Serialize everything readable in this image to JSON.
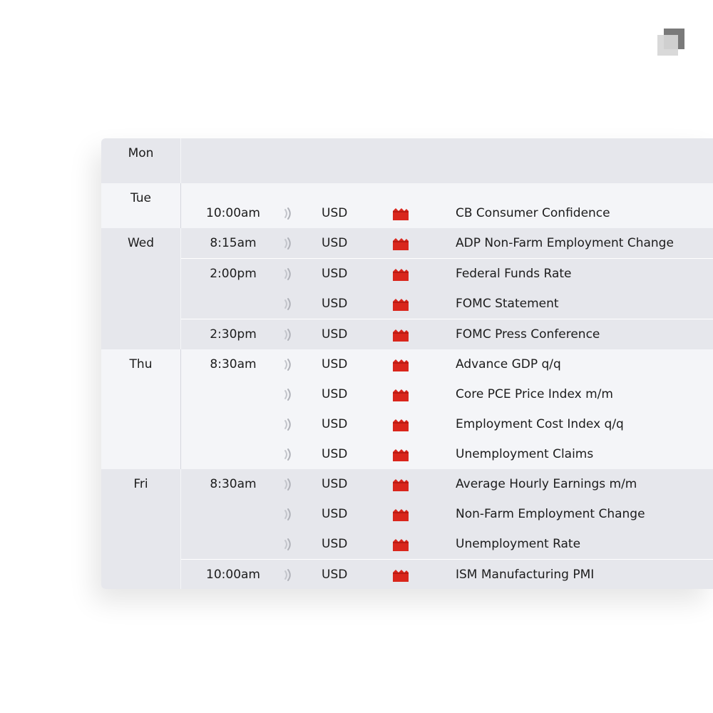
{
  "brand": {
    "logo": "square-logo"
  },
  "colors": {
    "impact_red": "#d9261c",
    "row_shade": "#e6e7ec",
    "row_light": "#f4f5f8"
  },
  "days": [
    {
      "label": "Mon",
      "groups": []
    },
    {
      "label": "Tue",
      "groups": [
        {
          "time": "10:00am",
          "events": [
            {
              "currency": "USD",
              "title": "CB Consumer Confidence"
            }
          ]
        }
      ]
    },
    {
      "label": "Wed",
      "groups": [
        {
          "time": "8:15am",
          "events": [
            {
              "currency": "USD",
              "title": "ADP Non-Farm Employment Change"
            }
          ]
        },
        {
          "time": "2:00pm",
          "events": [
            {
              "currency": "USD",
              "title": "Federal Funds Rate"
            },
            {
              "currency": "USD",
              "title": "FOMC Statement"
            }
          ]
        },
        {
          "time": "2:30pm",
          "events": [
            {
              "currency": "USD",
              "title": "FOMC Press Conference"
            }
          ]
        }
      ]
    },
    {
      "label": "Thu",
      "groups": [
        {
          "time": "8:30am",
          "events": [
            {
              "currency": "USD",
              "title": "Advance GDP q/q"
            },
            {
              "currency": "USD",
              "title": "Core PCE Price Index m/m"
            },
            {
              "currency": "USD",
              "title": "Employment Cost Index q/q"
            },
            {
              "currency": "USD",
              "title": "Unemployment Claims"
            }
          ]
        }
      ]
    },
    {
      "label": "Fri",
      "groups": [
        {
          "time": "8:30am",
          "events": [
            {
              "currency": "USD",
              "title": "Average Hourly Earnings m/m"
            },
            {
              "currency": "USD",
              "title": "Non-Farm Employment Change"
            },
            {
              "currency": "USD",
              "title": "Unemployment Rate"
            }
          ]
        },
        {
          "time": "10:00am",
          "events": [
            {
              "currency": "USD",
              "title": "ISM Manufacturing PMI"
            }
          ]
        }
      ]
    }
  ]
}
